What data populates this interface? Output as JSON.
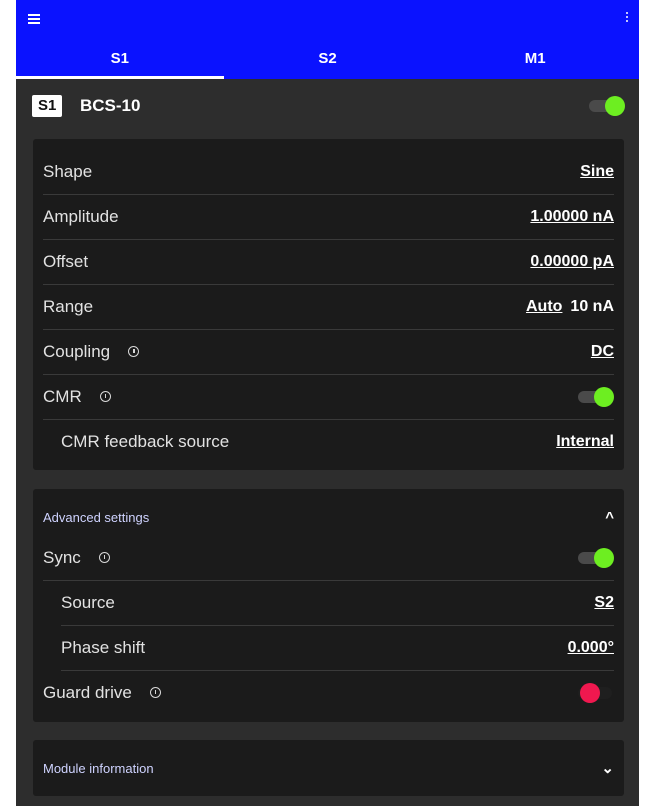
{
  "appbar": {
    "menu_icon": "hamburger-menu-icon",
    "more_icon": "vertical-dots-icon",
    "tabs": [
      {
        "label": "S1",
        "active": true
      },
      {
        "label": "S2",
        "active": false
      },
      {
        "label": "M1",
        "active": false
      }
    ]
  },
  "device": {
    "badge": "S1",
    "name": "BCS-10",
    "enabled": true
  },
  "settings": {
    "shape": {
      "label": "Shape",
      "value": "Sine"
    },
    "amplitude": {
      "label": "Amplitude",
      "value": "1.00000 nA"
    },
    "offset": {
      "label": "Offset",
      "value": "0.00000 pA"
    },
    "range": {
      "label": "Range",
      "mode": "Auto",
      "value": "10 nA"
    },
    "coupling": {
      "label": "Coupling",
      "value": "DC"
    },
    "cmr": {
      "label": "CMR",
      "enabled": true
    },
    "cmr_feedback": {
      "label": "CMR feedback source",
      "value": "Internal"
    }
  },
  "advanced": {
    "title": "Advanced settings",
    "expanded": true,
    "sync": {
      "label": "Sync",
      "enabled": true
    },
    "source": {
      "label": "Source",
      "value": "S2"
    },
    "phase_shift": {
      "label": "Phase shift",
      "value": "0.000°"
    },
    "guard_drive": {
      "label": "Guard drive",
      "enabled": false
    }
  },
  "module_info": {
    "title": "Module information",
    "expanded": false
  },
  "colors": {
    "appbar": "#0a12ff",
    "toggle_on": "#6dee21",
    "toggle_off": "#f0184f",
    "background": "#2d2d2d",
    "card": "#1b1b1b"
  }
}
